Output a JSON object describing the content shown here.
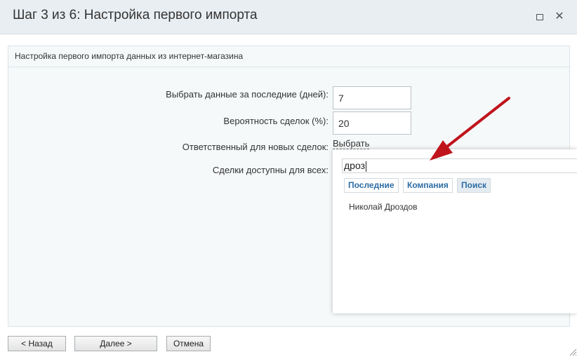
{
  "window": {
    "title": "Шаг 3 из 6: Настройка первого импорта",
    "maximize_icon": "maximize-icon",
    "close_icon": "close-icon",
    "close_glyph": "✕"
  },
  "panel": {
    "header": "Настройка первого импорта данных из интернет-магазина"
  },
  "form": {
    "days_label": "Выбрать данные за последние (дней):",
    "days_value": "7",
    "probability_label": "Вероятность сделок (%):",
    "probability_value": "20",
    "responsible_label": "Ответственный для новых сделок:",
    "responsible_link": "Выбрать",
    "available_label": "Сделки доступны для всех:"
  },
  "selector": {
    "search_value": "дроз",
    "tabs": [
      "Последние",
      "Компания",
      "Поиск"
    ],
    "active_tab": "Поиск",
    "results": [
      "Николай Дроздов"
    ]
  },
  "footer": {
    "back_label": "<  Назад",
    "next_label": "Далее    >",
    "cancel_label": "Отмена"
  },
  "colors": {
    "arrow": "#c0141c",
    "link": "#2e6da4",
    "titlebar": "#e9eef2"
  }
}
